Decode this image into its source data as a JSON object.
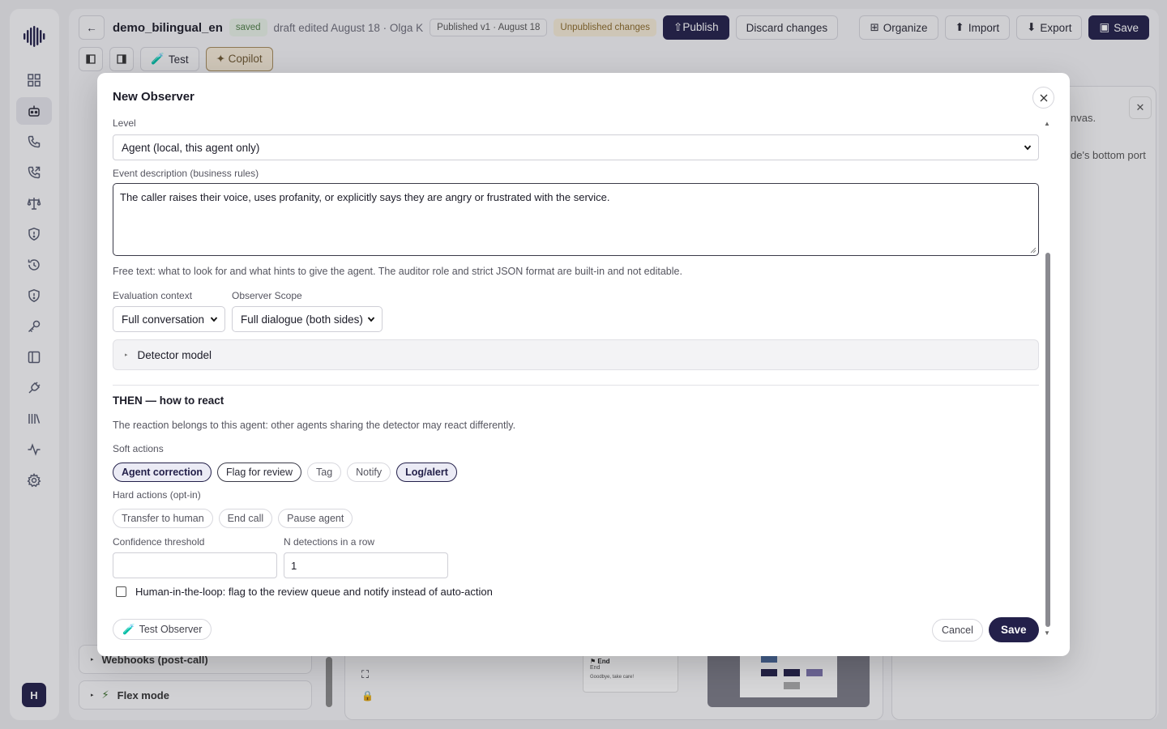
{
  "header": {
    "doc_title": "demo_bilingual_en",
    "saved_badge": "saved",
    "draft_info": "draft edited August 18 · Olga K",
    "published_badge": "Published v1 · August 18",
    "unpublished_badge": "Unpublished changes",
    "publish_label": "⇧Publish",
    "discard_label": "Discard changes",
    "organize_label": "Organize",
    "import_label": "Import",
    "export_label": "Export",
    "save_label": "Save"
  },
  "toolbar": {
    "test_label": "Test",
    "copilot_label": "✦ Copilot"
  },
  "left_col": {
    "webhooks_label": "Webhooks (post-call)",
    "flex_label": "Flex mode"
  },
  "right_panel": {
    "frag1": "nvas.",
    "frag2": "de's bottom port"
  },
  "canvas": {
    "end_node_title": "End",
    "end_node_sub": "End",
    "end_node_text": "Goodbye, take care!"
  },
  "modal": {
    "title": "New Observer",
    "level_label": "Level",
    "level_value": "Agent (local, this agent only)",
    "event_label": "Event description (business rules)",
    "event_value": "The caller raises their voice, uses profanity, or explicitly says they are angry or frustrated with the service.",
    "help_text": "Free text: what to look for and what hints to give the agent. The auditor role and strict JSON format are built-in and not editable.",
    "eval_context_label": "Evaluation context",
    "eval_context_value": "Full conversation",
    "scope_label": "Observer Scope",
    "scope_value": "Full dialogue (both sides)",
    "detector_label": "Detector model",
    "then_title": "THEN — how to react",
    "then_note": "The reaction belongs to this agent: other agents sharing the detector may react differently.",
    "soft_actions_label": "Soft actions",
    "soft_actions": [
      {
        "label": "Agent correction",
        "selected": true
      },
      {
        "label": "Flag for review",
        "selected": false
      },
      {
        "label": "Tag",
        "selected": false
      },
      {
        "label": "Notify",
        "selected": false
      },
      {
        "label": "Log/alert",
        "selected": true
      }
    ],
    "hard_actions_label": "Hard actions (opt-in)",
    "hard_actions": [
      {
        "label": "Transfer to human"
      },
      {
        "label": "End call"
      },
      {
        "label": "Pause agent"
      }
    ],
    "confidence_label": "Confidence threshold",
    "confidence_value": "",
    "n_detections_label": "N detections in a row",
    "n_detections_value": "1",
    "hitl_label": "Human-in-the-loop: flag to the review queue and notify instead of auto-action",
    "hitl_checked": false,
    "test_observer_label": "Test Observer",
    "cancel_label": "Cancel",
    "save_label": "Save"
  },
  "user": {
    "avatar_initial": "H"
  },
  "colors": {
    "accent": "#23204a",
    "copilot_bg": "#f4e9d6",
    "saved_bg": "#e6efe4"
  }
}
